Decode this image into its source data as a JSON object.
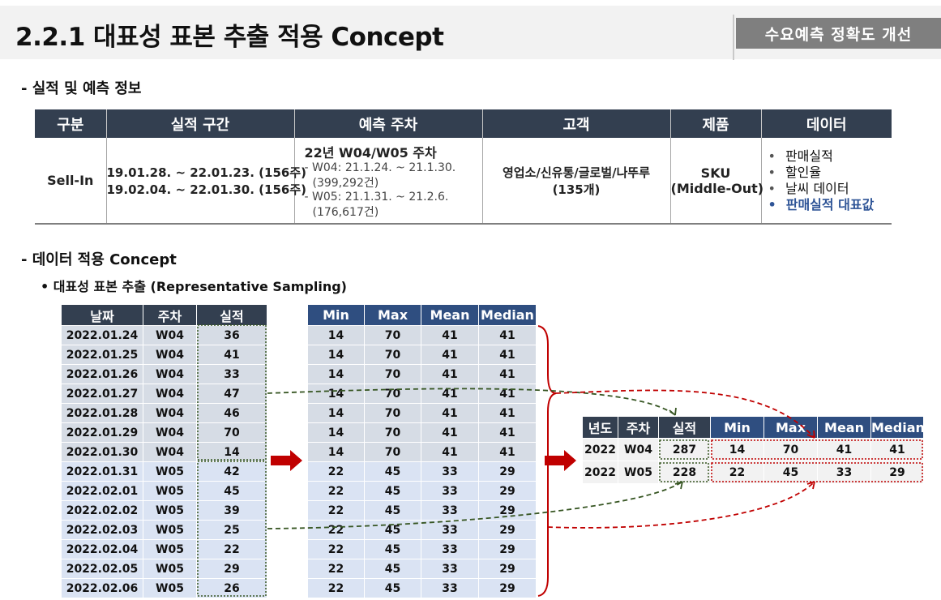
{
  "header": {
    "title": "2.2.1 대표성 표본 추출 적용 Concept",
    "badge": "수요예측  정확도 개선"
  },
  "section1": {
    "heading": "- 실적 및 예측 정보",
    "table": {
      "columns": [
        "구분",
        "실적 구간",
        "예측 주차",
        "고객",
        "제품",
        "데이터"
      ],
      "row": {
        "type": "Sell-In",
        "periods": [
          "19.01.28. ~ 22.01.23. (156주)",
          "19.02.04. ~ 22.01.30. (156주)"
        ],
        "forecast": {
          "title": "22년 W04/W05 주차",
          "items": [
            "- W04: 21.1.24. ~ 21.1.30.",
            "  (399,292건)",
            "- W05: 21.1.31. ~ 21.2.6.",
            "  (176,617건)"
          ]
        },
        "customer": [
          "영업소/신유통/글로벌/나뚜루",
          "(135개)"
        ],
        "product": [
          "SKU",
          "(Middle-Out)"
        ],
        "data": [
          "판매실적",
          "할인율",
          "날씨 데이터",
          "판매실적 대표값"
        ]
      }
    }
  },
  "section2": {
    "heading": "- 데이터 적용 Concept",
    "subheading": "•  대표성 표본 추출 (Representative Sampling)",
    "daily": {
      "columns": [
        "날짜",
        "주차",
        "실적"
      ],
      "rows": [
        [
          "2022.01.24",
          "W04",
          "36"
        ],
        [
          "2022.01.25",
          "W04",
          "41"
        ],
        [
          "2022.01.26",
          "W04",
          "33"
        ],
        [
          "2022.01.27",
          "W04",
          "47"
        ],
        [
          "2022.01.28",
          "W04",
          "46"
        ],
        [
          "2022.01.29",
          "W04",
          "70"
        ],
        [
          "2022.01.30",
          "W04",
          "14"
        ],
        [
          "2022.01.31",
          "W05",
          "42"
        ],
        [
          "2022.02.01",
          "W05",
          "45"
        ],
        [
          "2022.02.02",
          "W05",
          "39"
        ],
        [
          "2022.02.03",
          "W05",
          "25"
        ],
        [
          "2022.02.04",
          "W05",
          "22"
        ],
        [
          "2022.02.05",
          "W05",
          "29"
        ],
        [
          "2022.02.06",
          "W05",
          "26"
        ]
      ]
    },
    "stats": {
      "columns": [
        "Min",
        "Max",
        "Mean",
        "Median"
      ],
      "rows": [
        [
          "14",
          "70",
          "41",
          "41"
        ],
        [
          "14",
          "70",
          "41",
          "41"
        ],
        [
          "14",
          "70",
          "41",
          "41"
        ],
        [
          "14",
          "70",
          "41",
          "41"
        ],
        [
          "14",
          "70",
          "41",
          "41"
        ],
        [
          "14",
          "70",
          "41",
          "41"
        ],
        [
          "14",
          "70",
          "41",
          "41"
        ],
        [
          "22",
          "45",
          "33",
          "29"
        ],
        [
          "22",
          "45",
          "33",
          "29"
        ],
        [
          "22",
          "45",
          "33",
          "29"
        ],
        [
          "22",
          "45",
          "33",
          "29"
        ],
        [
          "22",
          "45",
          "33",
          "29"
        ],
        [
          "22",
          "45",
          "33",
          "29"
        ],
        [
          "22",
          "45",
          "33",
          "29"
        ]
      ]
    },
    "summary": {
      "columns": [
        "년도",
        "주차",
        "실적",
        "Min",
        "Max",
        "Mean",
        "Median"
      ],
      "rows": [
        [
          "2022",
          "W04",
          "287",
          "14",
          "70",
          "41",
          "41"
        ],
        [
          "2022",
          "W05",
          "228",
          "22",
          "45",
          "33",
          "29"
        ]
      ]
    }
  },
  "colors": {
    "header_dark": "#333f50",
    "header_blue": "#2f4e80",
    "row_w04": "#d6dce5",
    "row_w05": "#dae3f3",
    "arrow_red": "#c00000",
    "dashed_green": "#375623",
    "highlight_text": "#2f5597"
  }
}
